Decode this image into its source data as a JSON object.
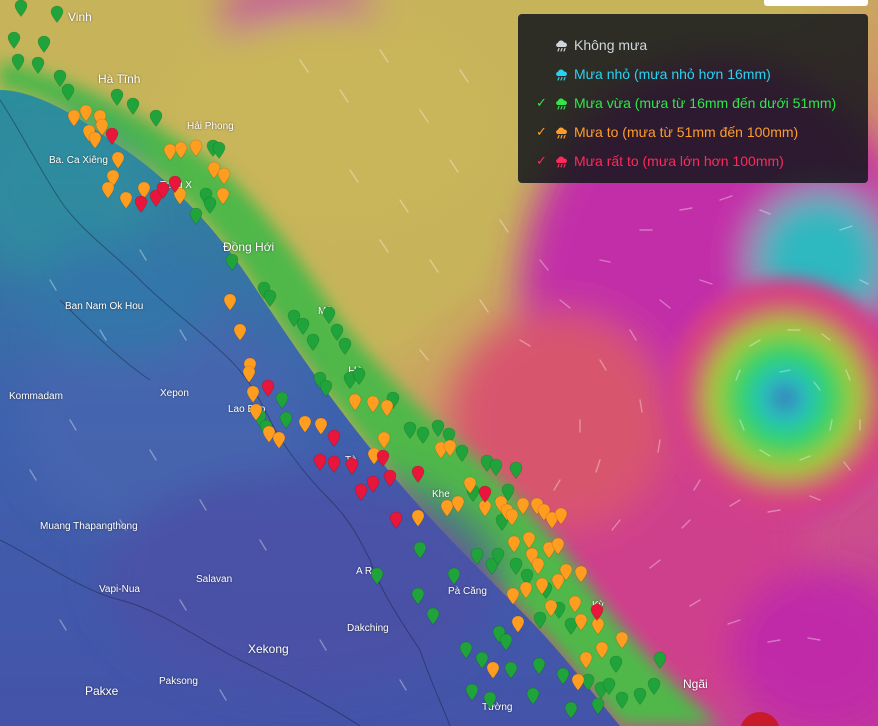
{
  "legend": {
    "items": [
      {
        "label": "Không mưa",
        "color": "#cfd6dc",
        "checked": false
      },
      {
        "label": "Mưa nhỏ (mưa nhỏ hơn 16mm)",
        "color": "#27d3f2",
        "checked": false
      },
      {
        "label": "Mưa vừa (mưa từ 16mm đến dưới 51mm)",
        "color": "#2ee84a",
        "checked": true
      },
      {
        "label": "Mưa to (mưa từ 51mm đến 100mm)",
        "color": "#ff9d2b",
        "checked": true
      },
      {
        "label": "Mưa rất to (mưa lớn hơn 100mm)",
        "color": "#ff2a5a",
        "checked": true
      }
    ],
    "check_glyph": "✓"
  },
  "places": [
    {
      "name": "Vinh",
      "id": "vinh"
    },
    {
      "name": "Hà Tĩnh",
      "id": "ha-tinh"
    },
    {
      "name": "Hải Phong",
      "id": "hai-phong"
    },
    {
      "name": "Ba. Ca Xiêng",
      "id": "ba-ca-xieng"
    },
    {
      "name": "Tr...g X",
      "id": "truong-x"
    },
    {
      "name": "Đồng Hới",
      "id": "dong-hoi"
    },
    {
      "name": "Ban Nam Ok Hou",
      "id": "ban-nam-ok-hou"
    },
    {
      "name": "Mô",
      "id": "mo"
    },
    {
      "name": "Kommadam",
      "id": "kommadam"
    },
    {
      "name": "Xepon",
      "id": "xepon"
    },
    {
      "name": "Lao Bảo",
      "id": "lao-bao"
    },
    {
      "name": "Hà",
      "id": "ha"
    },
    {
      "name": "Tà",
      "id": "ta"
    },
    {
      "name": "Khe",
      "id": "khe"
    },
    {
      "name": "Muang Thapangthong",
      "id": "muang-thapangthong"
    },
    {
      "name": "A Ro",
      "id": "a-ro"
    },
    {
      "name": "Salavan",
      "id": "salavan"
    },
    {
      "name": "Vapi-Nua",
      "id": "vapi-nua"
    },
    {
      "name": "Pà Căng",
      "id": "pa-cang"
    },
    {
      "name": "Kỳ",
      "id": "ky"
    },
    {
      "name": "Dakching",
      "id": "dakching"
    },
    {
      "name": "Xekong",
      "id": "xekong"
    },
    {
      "name": "Paksong",
      "id": "paksong"
    },
    {
      "name": "Pakxe",
      "id": "pakxe"
    },
    {
      "name": "Ngãi",
      "id": "ngai"
    },
    {
      "name": "Tường",
      "id": "tuong"
    }
  ],
  "colors": {
    "green": "#1fa33a",
    "orange": "#ff9d20",
    "red": "#e8163a"
  },
  "markers": {
    "green": [
      [
        14,
        40
      ],
      [
        21,
        8
      ],
      [
        57,
        14
      ],
      [
        44,
        44
      ],
      [
        18,
        62
      ],
      [
        38,
        65
      ],
      [
        60,
        78
      ],
      [
        68,
        92
      ],
      [
        117,
        97
      ],
      [
        133,
        106
      ],
      [
        156,
        118
      ],
      [
        213,
        148
      ],
      [
        219,
        150
      ],
      [
        206,
        196
      ],
      [
        210,
        205
      ],
      [
        196,
        216
      ],
      [
        232,
        262
      ],
      [
        264,
        290
      ],
      [
        270,
        298
      ],
      [
        294,
        318
      ],
      [
        303,
        326
      ],
      [
        329,
        315
      ],
      [
        337,
        332
      ],
      [
        345,
        346
      ],
      [
        313,
        342
      ],
      [
        320,
        380
      ],
      [
        326,
        388
      ],
      [
        350,
        380
      ],
      [
        359,
        376
      ],
      [
        282,
        400
      ],
      [
        260,
        418
      ],
      [
        286,
        420
      ],
      [
        266,
        428
      ],
      [
        393,
        400
      ],
      [
        410,
        430
      ],
      [
        423,
        435
      ],
      [
        438,
        428
      ],
      [
        449,
        436
      ],
      [
        462,
        453
      ],
      [
        487,
        463
      ],
      [
        496,
        467
      ],
      [
        516,
        470
      ],
      [
        473,
        493
      ],
      [
        508,
        492
      ],
      [
        502,
        522
      ],
      [
        477,
        556
      ],
      [
        492,
        566
      ],
      [
        498,
        556
      ],
      [
        516,
        566
      ],
      [
        527,
        577
      ],
      [
        546,
        590
      ],
      [
        377,
        576
      ],
      [
        420,
        550
      ],
      [
        454,
        576
      ],
      [
        418,
        596
      ],
      [
        433,
        616
      ],
      [
        540,
        620
      ],
      [
        571,
        626
      ],
      [
        559,
        610
      ],
      [
        499,
        634
      ],
      [
        506,
        642
      ],
      [
        466,
        650
      ],
      [
        482,
        660
      ],
      [
        511,
        670
      ],
      [
        539,
        666
      ],
      [
        563,
        676
      ],
      [
        588,
        682
      ],
      [
        601,
        690
      ],
      [
        616,
        664
      ],
      [
        609,
        686
      ],
      [
        654,
        686
      ],
      [
        622,
        700
      ],
      [
        640,
        696
      ],
      [
        660,
        660
      ],
      [
        472,
        692
      ],
      [
        490,
        700
      ],
      [
        533,
        696
      ],
      [
        571,
        710
      ],
      [
        598,
        706
      ]
    ],
    "orange": [
      [
        74,
        118
      ],
      [
        86,
        113
      ],
      [
        100,
        118
      ],
      [
        102,
        127
      ],
      [
        89,
        133
      ],
      [
        95,
        140
      ],
      [
        118,
        160
      ],
      [
        113,
        178
      ],
      [
        108,
        190
      ],
      [
        126,
        200
      ],
      [
        144,
        190
      ],
      [
        170,
        152
      ],
      [
        181,
        150
      ],
      [
        196,
        148
      ],
      [
        214,
        170
      ],
      [
        224,
        176
      ],
      [
        223,
        196
      ],
      [
        180,
        196
      ],
      [
        230,
        302
      ],
      [
        240,
        332
      ],
      [
        250,
        366
      ],
      [
        249,
        374
      ],
      [
        253,
        394
      ],
      [
        256,
        412
      ],
      [
        269,
        434
      ],
      [
        279,
        440
      ],
      [
        305,
        424
      ],
      [
        321,
        426
      ],
      [
        355,
        402
      ],
      [
        373,
        404
      ],
      [
        387,
        408
      ],
      [
        384,
        440
      ],
      [
        374,
        456
      ],
      [
        418,
        518
      ],
      [
        441,
        450
      ],
      [
        450,
        448
      ],
      [
        447,
        508
      ],
      [
        458,
        504
      ],
      [
        470,
        485
      ],
      [
        485,
        508
      ],
      [
        501,
        504
      ],
      [
        507,
        512
      ],
      [
        512,
        517
      ],
      [
        523,
        506
      ],
      [
        537,
        506
      ],
      [
        544,
        512
      ],
      [
        552,
        520
      ],
      [
        561,
        516
      ],
      [
        514,
        544
      ],
      [
        529,
        540
      ],
      [
        532,
        556
      ],
      [
        538,
        566
      ],
      [
        549,
        550
      ],
      [
        558,
        546
      ],
      [
        566,
        572
      ],
      [
        581,
        574
      ],
      [
        513,
        596
      ],
      [
        526,
        590
      ],
      [
        542,
        586
      ],
      [
        558,
        582
      ],
      [
        551,
        608
      ],
      [
        575,
        604
      ],
      [
        518,
        624
      ],
      [
        581,
        622
      ],
      [
        598,
        626
      ],
      [
        602,
        650
      ],
      [
        586,
        660
      ],
      [
        578,
        682
      ],
      [
        622,
        640
      ],
      [
        493,
        670
      ]
    ],
    "red": [
      [
        112,
        136
      ],
      [
        141,
        204
      ],
      [
        156,
        198
      ],
      [
        163,
        190
      ],
      [
        175,
        184
      ],
      [
        268,
        388
      ],
      [
        334,
        438
      ],
      [
        320,
        462
      ],
      [
        334,
        464
      ],
      [
        352,
        466
      ],
      [
        383,
        458
      ],
      [
        361,
        492
      ],
      [
        373,
        484
      ],
      [
        390,
        478
      ],
      [
        418,
        474
      ],
      [
        396,
        520
      ],
      [
        485,
        494
      ],
      [
        597,
        612
      ]
    ]
  }
}
